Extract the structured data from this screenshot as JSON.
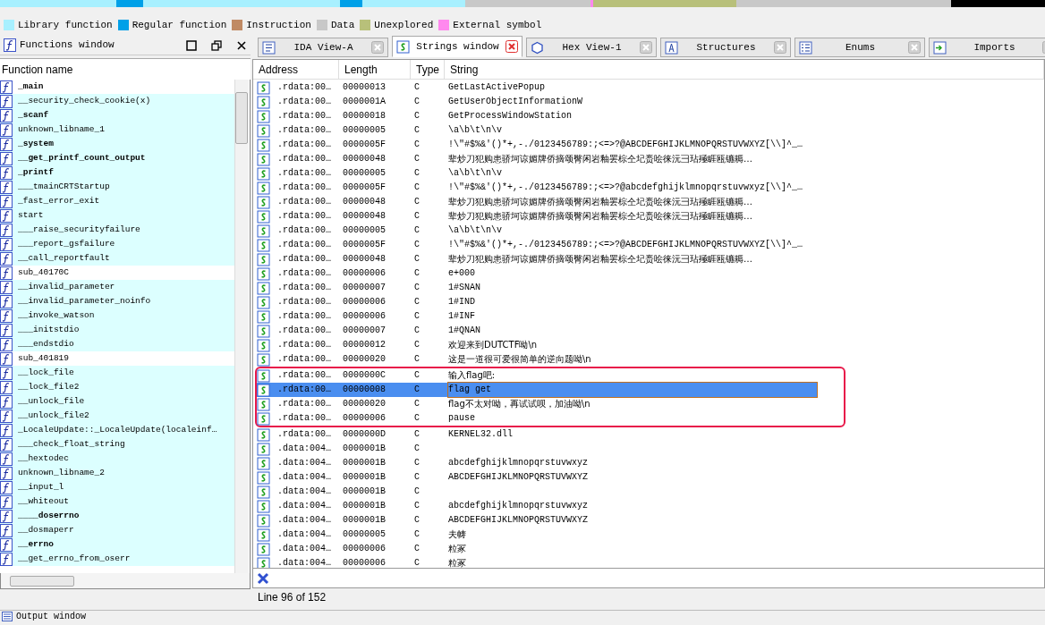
{
  "legend": [
    {
      "label": "Library function",
      "color": "#a8f0ff"
    },
    {
      "label": "Regular function",
      "color": "#00a0e8"
    },
    {
      "label": "Instruction",
      "color": "#c08a64"
    },
    {
      "label": "Data",
      "color": "#c8c8c8"
    },
    {
      "label": "Unexplored",
      "color": "#b8c07a"
    },
    {
      "label": "External symbol",
      "color": "#ff88ee"
    }
  ],
  "functions_window": {
    "title": "Functions window",
    "column": "Function name",
    "items": [
      {
        "name": "_main",
        "kind": "regular",
        "bold": true
      },
      {
        "name": "__security_check_cookie(x)",
        "kind": "library",
        "bold": false
      },
      {
        "name": "_scanf",
        "kind": "library",
        "bold": true
      },
      {
        "name": "unknown_libname_1",
        "kind": "library",
        "bold": false
      },
      {
        "name": "_system",
        "kind": "library",
        "bold": true
      },
      {
        "name": "__get_printf_count_output",
        "kind": "library",
        "bold": true
      },
      {
        "name": "_printf",
        "kind": "library",
        "bold": true
      },
      {
        "name": "___tmainCRTStartup",
        "kind": "library",
        "bold": false
      },
      {
        "name": "_fast_error_exit",
        "kind": "library",
        "bold": false
      },
      {
        "name": "start",
        "kind": "library",
        "bold": false
      },
      {
        "name": "___raise_securityfailure",
        "kind": "library",
        "bold": false
      },
      {
        "name": "___report_gsfailure",
        "kind": "library",
        "bold": false
      },
      {
        "name": "__call_reportfault",
        "kind": "library",
        "bold": false
      },
      {
        "name": "sub_40170C",
        "kind": "regular",
        "bold": false
      },
      {
        "name": "__invalid_parameter",
        "kind": "library",
        "bold": false
      },
      {
        "name": "__invalid_parameter_noinfo",
        "kind": "library",
        "bold": false
      },
      {
        "name": "__invoke_watson",
        "kind": "library",
        "bold": false
      },
      {
        "name": "___initstdio",
        "kind": "library",
        "bold": false
      },
      {
        "name": "___endstdio",
        "kind": "library",
        "bold": false
      },
      {
        "name": "sub_401819",
        "kind": "regular",
        "bold": false
      },
      {
        "name": "__lock_file",
        "kind": "library",
        "bold": false
      },
      {
        "name": "__lock_file2",
        "kind": "library",
        "bold": false
      },
      {
        "name": "__unlock_file",
        "kind": "library",
        "bold": false
      },
      {
        "name": "__unlock_file2",
        "kind": "library",
        "bold": false
      },
      {
        "name": "_LocaleUpdate::_LocaleUpdate(localeinf…",
        "kind": "library",
        "bold": false
      },
      {
        "name": "___check_float_string",
        "kind": "library",
        "bold": false
      },
      {
        "name": "__hextodec",
        "kind": "library",
        "bold": false
      },
      {
        "name": "unknown_libname_2",
        "kind": "library",
        "bold": false
      },
      {
        "name": "__input_l",
        "kind": "library",
        "bold": false
      },
      {
        "name": "__whiteout",
        "kind": "library",
        "bold": false
      },
      {
        "name": "____doserrno",
        "kind": "library",
        "bold": true
      },
      {
        "name": "__dosmaperr",
        "kind": "library",
        "bold": false
      },
      {
        "name": "__errno",
        "kind": "library",
        "bold": true
      },
      {
        "name": "__get_errno_from_oserr",
        "kind": "library",
        "bold": false
      }
    ]
  },
  "tabs": [
    {
      "label": "IDA View-A",
      "selected": false
    },
    {
      "label": "Strings window",
      "selected": true
    },
    {
      "label": "Hex View-1",
      "selected": false
    },
    {
      "label": "Structures",
      "selected": false
    },
    {
      "label": "Enums",
      "selected": false
    },
    {
      "label": "Imports",
      "selected": false
    }
  ],
  "strings_window": {
    "columns": [
      "Address",
      "Length",
      "Type",
      "String"
    ],
    "rows": [
      {
        "address": ".rdata:00…",
        "length": "00000013",
        "type": "C",
        "string": "GetLastActivePopup",
        "selected": false,
        "circled": false
      },
      {
        "address": ".rdata:00…",
        "length": "0000001A",
        "type": "C",
        "string": "GetUserObjectInformationW",
        "selected": false,
        "circled": false
      },
      {
        "address": ".rdata:00…",
        "length": "00000018",
        "type": "C",
        "string": "GetProcessWindowStation",
        "selected": false,
        "circled": false
      },
      {
        "address": ".rdata:00…",
        "length": "00000005",
        "type": "C",
        "string": "\\a\\b\\t\\n\\v",
        "selected": false,
        "circled": false
      },
      {
        "address": ".rdata:00…",
        "length": "0000005F",
        "type": "C",
        "string": " !\\\"#$%&'()*+,-./0123456789:;<=>?@ABCDEFGHIJKLMNOPQRSTUVWXYZ[\\\\]^_…",
        "selected": false,
        "circled": false
      },
      {
        "address": ".rdata:00…",
        "length": "00000048",
        "type": "C",
        "string": "辈炒刀犯购患骄坷谅媚牌侨摘颂臀闲岩釉罢棕仝圮赉哙徕沅彐玷殛睚瓯镳耨…",
        "selected": false,
        "circled": false
      },
      {
        "address": ".rdata:00…",
        "length": "00000005",
        "type": "C",
        "string": "\\a\\b\\t\\n\\v",
        "selected": false,
        "circled": false
      },
      {
        "address": ".rdata:00…",
        "length": "0000005F",
        "type": "C",
        "string": " !\\\"#$%&'()*+,-./0123456789:;<=>?@abcdefghijklmnopqrstuvwxyz[\\\\]^_…",
        "selected": false,
        "circled": false
      },
      {
        "address": ".rdata:00…",
        "length": "00000048",
        "type": "C",
        "string": "辈炒刀犯购患骄坷谅媚牌侨摘颂臀闲岩釉罢棕仝圮赉哙徕沅彐玷殛睚瓯镳耨…",
        "selected": false,
        "circled": false
      },
      {
        "address": ".rdata:00…",
        "length": "00000048",
        "type": "C",
        "string": "辈炒刀犯购患骄坷谅媚牌侨摘颂臀闲岩釉罢棕仝圮赉哙徕沅彐玷殛睚瓯镳耨…",
        "selected": false,
        "circled": false
      },
      {
        "address": ".rdata:00…",
        "length": "00000005",
        "type": "C",
        "string": "\\a\\b\\t\\n\\v",
        "selected": false,
        "circled": false
      },
      {
        "address": ".rdata:00…",
        "length": "0000005F",
        "type": "C",
        "string": " !\\\"#$%&'()*+,-./0123456789:;<=>?@ABCDEFGHIJKLMNOPQRSTUVWXYZ[\\\\]^_…",
        "selected": false,
        "circled": false
      },
      {
        "address": ".rdata:00…",
        "length": "00000048",
        "type": "C",
        "string": "辈炒刀犯购患骄坷谅媚牌侨摘颂臀闲岩釉罢棕仝圮赉哙徕沅彐玷殛睚瓯镳耨…",
        "selected": false,
        "circled": false
      },
      {
        "address": ".rdata:00…",
        "length": "00000006",
        "type": "C",
        "string": "e+000",
        "selected": false,
        "circled": false
      },
      {
        "address": ".rdata:00…",
        "length": "00000007",
        "type": "C",
        "string": "1#SNAN",
        "selected": false,
        "circled": false
      },
      {
        "address": ".rdata:00…",
        "length": "00000006",
        "type": "C",
        "string": "1#IND",
        "selected": false,
        "circled": false
      },
      {
        "address": ".rdata:00…",
        "length": "00000006",
        "type": "C",
        "string": "1#INF",
        "selected": false,
        "circled": false
      },
      {
        "address": ".rdata:00…",
        "length": "00000007",
        "type": "C",
        "string": "1#QNAN",
        "selected": false,
        "circled": false
      },
      {
        "address": ".rdata:00…",
        "length": "00000012",
        "type": "C",
        "string": "欢迎来到DUTCTF呦\\n",
        "selected": false,
        "circled": false
      },
      {
        "address": ".rdata:00…",
        "length": "00000020",
        "type": "C",
        "string": "这是一道很可爱很简单的逆向题呦\\n",
        "selected": false,
        "circled": false
      },
      {
        "address": ".rdata:00…",
        "length": "0000000C",
        "type": "C",
        "string": "输入flag吧:",
        "selected": false,
        "circled": true
      },
      {
        "address": ".rdata:00…",
        "length": "00000008",
        "type": "C",
        "string": "flag get",
        "selected": true,
        "circled": true
      },
      {
        "address": ".rdata:00…",
        "length": "00000020",
        "type": "C",
        "string": "flag不太对呦，再试试呗，加油呦\\n",
        "selected": false,
        "circled": true
      },
      {
        "address": ".rdata:00…",
        "length": "00000006",
        "type": "C",
        "string": "pause",
        "selected": false,
        "circled": true
      },
      {
        "address": ".rdata:00…",
        "length": "0000000D",
        "type": "C",
        "string": "KERNEL32.dll",
        "selected": false,
        "circled": false
      },
      {
        "address": ".data:004…",
        "length": "0000001B",
        "type": "C",
        "selected": false,
        "circled": false
      },
      {
        "address": ".data:004…",
        "length": "0000001B",
        "type": "C",
        "string": "abcdefghijklmnopqrstuvwxyz",
        "selected": false,
        "circled": false
      },
      {
        "address": ".data:004…",
        "length": "0000001B",
        "type": "C",
        "string": "ABCDEFGHIJKLMNOPQRSTUVWXYZ",
        "selected": false,
        "circled": false
      },
      {
        "address": ".data:004…",
        "length": "0000001B",
        "type": "C",
        "selected": false,
        "circled": false
      },
      {
        "address": ".data:004…",
        "length": "0000001B",
        "type": "C",
        "string": "abcdefghijklmnopqrstuvwxyz",
        "selected": false,
        "circled": false
      },
      {
        "address": ".data:004…",
        "length": "0000001B",
        "type": "C",
        "string": "ABCDEFGHIJKLMNOPQRSTUVWXYZ",
        "selected": false,
        "circled": false
      },
      {
        "address": ".data:004…",
        "length": "00000005",
        "type": "C",
        "string": "夫帱",
        "selected": false,
        "circled": false
      },
      {
        "address": ".data:004…",
        "length": "00000006",
        "type": "C",
        "string": "粒冢",
        "selected": false,
        "circled": false
      },
      {
        "address": ".data:004…",
        "length": "00000006",
        "type": "C",
        "string": "粒冢",
        "selected": false,
        "circled": false
      }
    ]
  },
  "status_bar": "Line 96 of 152",
  "output_window": {
    "title": "Output window"
  }
}
